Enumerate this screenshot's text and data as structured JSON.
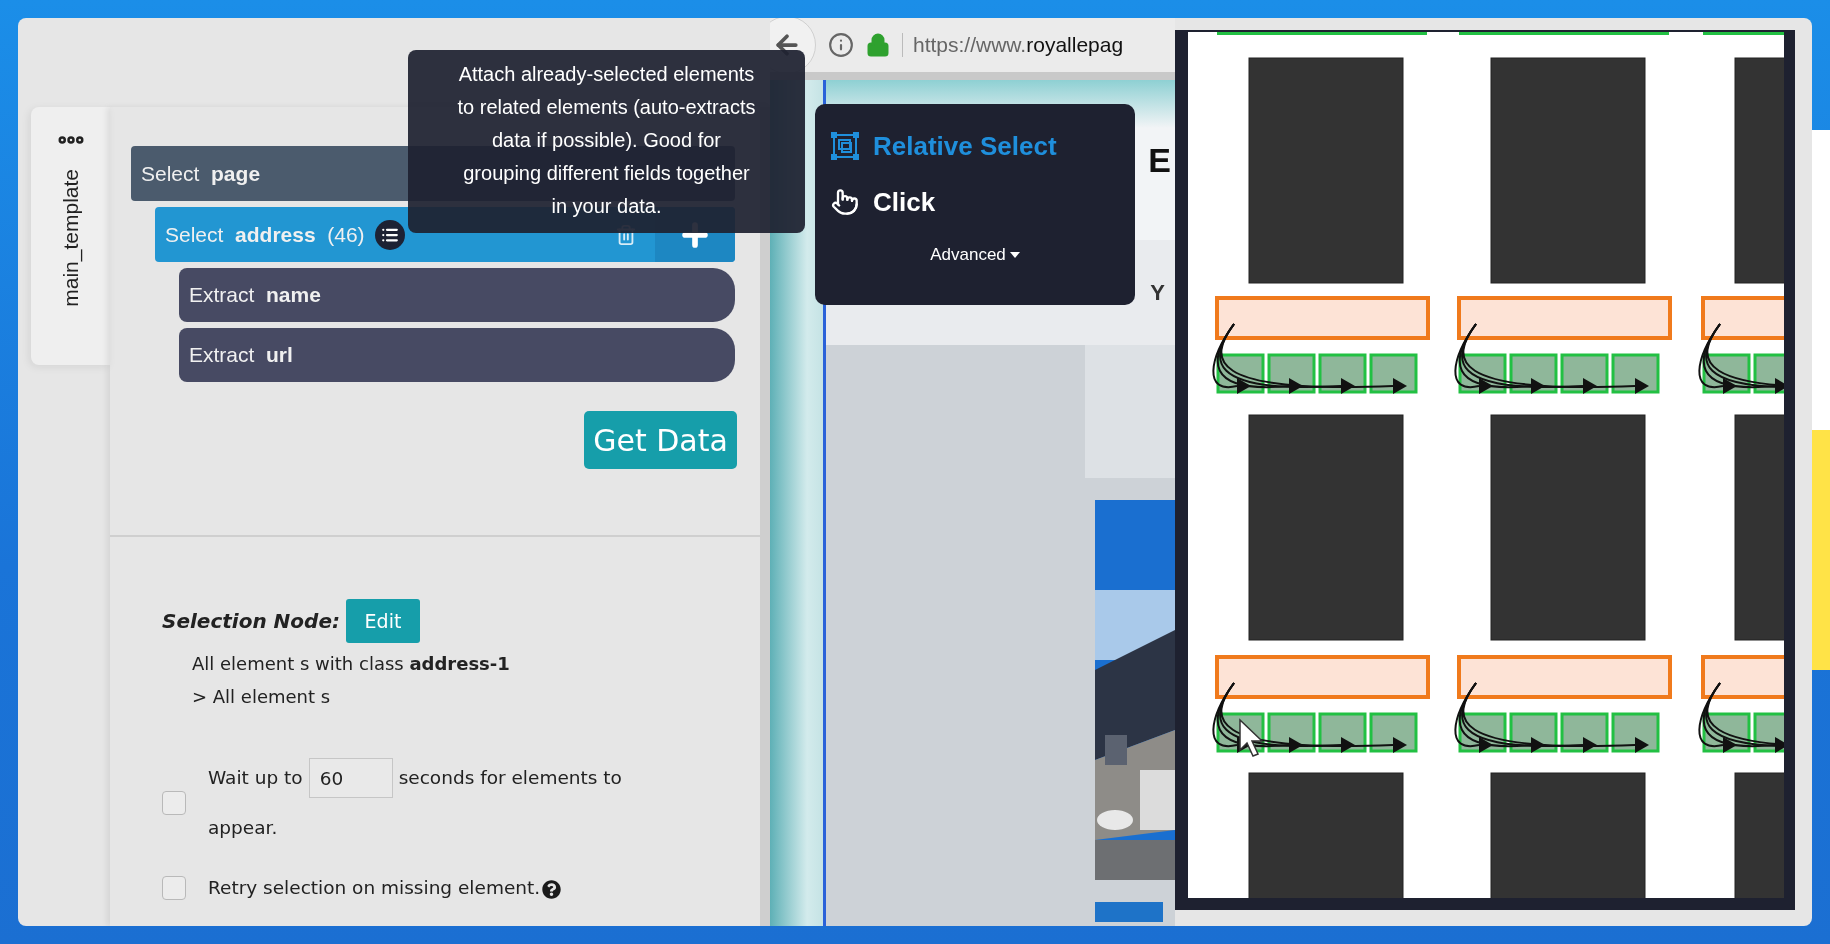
{
  "sidebar_tab": {
    "label": "main_template"
  },
  "tree": [
    {
      "kind": "select",
      "verb": "Select",
      "target": "page",
      "selected": false,
      "children": [
        {
          "kind": "select",
          "verb": "Select",
          "target": "address",
          "count": "(46)",
          "selected": true,
          "children": [
            {
              "kind": "extract",
              "verb": "Extract",
              "target": "name",
              "selected": false
            },
            {
              "kind": "extract",
              "verb": "Extract",
              "target": "url",
              "selected": false
            }
          ]
        }
      ]
    }
  ],
  "get_data_button": "Get Data",
  "selection_node": {
    "label": "Selection Node:",
    "edit_button": "Edit",
    "description": [
      "All element s with class **address-1**",
      "> All element s"
    ]
  },
  "options": [
    {
      "kind": "wait",
      "checked": false,
      "before": "Wait up to",
      "value": "60",
      "after": "seconds for elements to",
      "after_line2": "appear."
    },
    {
      "kind": "plain",
      "checked": false,
      "label": "Retry selection on missing element."
    }
  ],
  "browser": {
    "url_prefix": "https://www.",
    "url_host": "royallepag",
    "header_letter": "E",
    "nav_letter": "Y"
  },
  "tooltip": [
    "Attach already-selected elements",
    "to related elements (auto-extracts",
    "data if possible). Good for",
    "grouping different fields together",
    "in your data."
  ],
  "menu": {
    "items": [
      {
        "kind": "relative",
        "label": "Relative Select",
        "selected": true
      },
      {
        "kind": "click",
        "label": "Click",
        "selected": false
      }
    ],
    "advanced": "Advanced"
  }
}
